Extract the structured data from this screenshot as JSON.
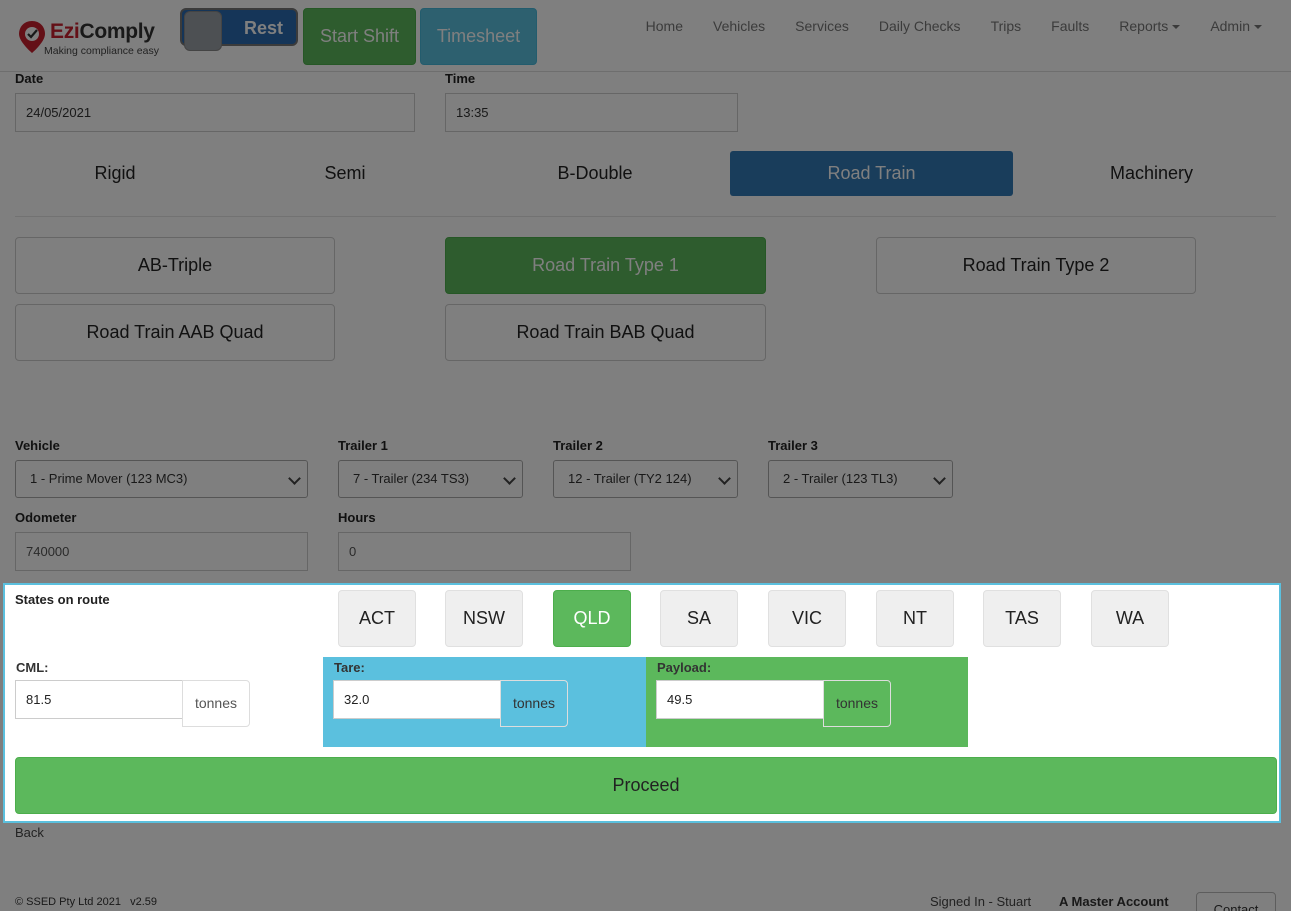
{
  "header": {
    "logo_text_ezi": "Ezi",
    "logo_text_comply": "Comply",
    "logo_tagline": "Making compliance easy",
    "rest_label": "Rest",
    "start_shift_label": "Start Shift",
    "timesheet_label": "Timesheet",
    "nav": [
      "Home",
      "Vehicles",
      "Services",
      "Daily Checks",
      "Trips",
      "Faults",
      "Reports",
      "Admin"
    ]
  },
  "form": {
    "date_label": "Date",
    "date_value": "24/05/2021",
    "time_label": "Time",
    "time_value": "13:35",
    "vehicle_types": [
      "Rigid",
      "Semi",
      "B-Double",
      "Road Train",
      "Machinery"
    ],
    "selected_vehicle_type": "Road Train",
    "combinations": [
      "AB-Triple",
      "Road Train Type 1",
      "Road Train Type 2",
      "Road Train AAB Quad",
      "Road Train BAB Quad"
    ],
    "selected_combination": "Road Train Type 1",
    "vehicle_label": "Vehicle",
    "vehicle_value": "1 - Prime Mover (123 MC3)",
    "trailer1_label": "Trailer 1",
    "trailer1_value": "7 - Trailer (234 TS3)",
    "trailer2_label": "Trailer 2",
    "trailer2_value": "12 - Trailer (TY2 124)",
    "trailer3_label": "Trailer 3",
    "trailer3_value": "2 - Trailer (123 TL3)",
    "odometer_label": "Odometer",
    "odometer_value": "740000",
    "hours_label": "Hours",
    "hours_value": "0"
  },
  "route": {
    "states_label": "States on route",
    "states": [
      "ACT",
      "NSW",
      "QLD",
      "SA",
      "VIC",
      "NT",
      "TAS",
      "WA"
    ],
    "selected_state": "QLD",
    "cml_label": "CML:",
    "cml_value": "81.5",
    "tare_label": "Tare:",
    "tare_value": "32.0",
    "payload_label": "Payload:",
    "payload_value": "49.5",
    "unit": "tonnes",
    "proceed_label": "Proceed"
  },
  "footer": {
    "back_label": "Back",
    "copyright": "© SSED Pty Ltd 2021",
    "version": "v2.59",
    "signed_in": "Signed In - Stuart",
    "account": "A Master Account",
    "contact_label": "Contact"
  },
  "colors": {
    "primary": "#337ab7",
    "success": "#5cb85c",
    "info": "#5bc0de",
    "cml_bg": "#ffffff",
    "tare_bg": "#5bc0de",
    "payload_bg": "#5cb85c",
    "brand_red": "#c8202f"
  }
}
